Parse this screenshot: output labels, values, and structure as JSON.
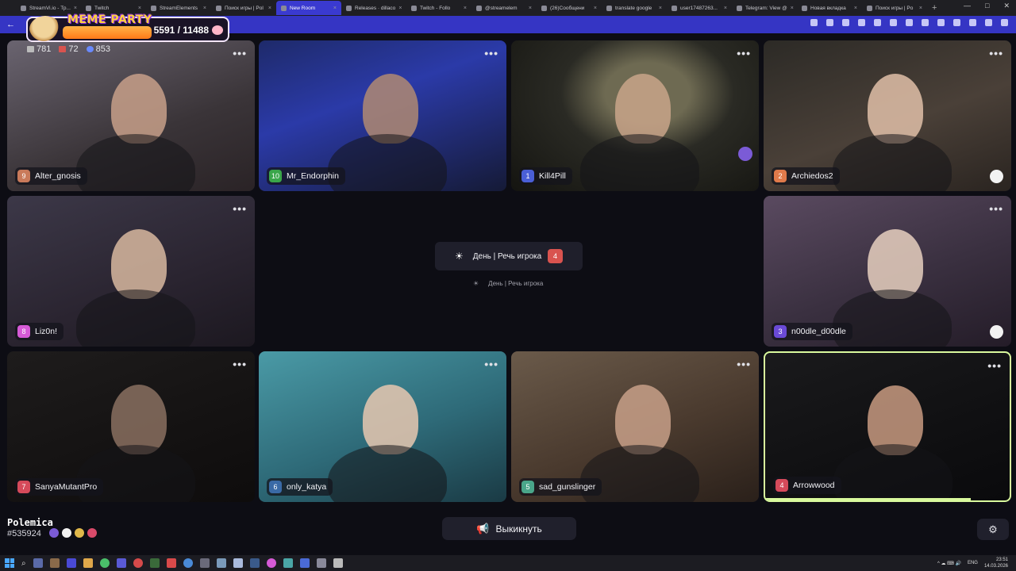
{
  "browser": {
    "tabs": [
      {
        "label": "StreamVi.io - Тр..."
      },
      {
        "label": "Twitch"
      },
      {
        "label": "StreamElements"
      },
      {
        "label": "Поиск игры | Pol"
      },
      {
        "label": "New Room",
        "active": true
      },
      {
        "label": "Releases · dillaco"
      },
      {
        "label": "Twitch - Follo"
      },
      {
        "label": "@streamelem"
      },
      {
        "label": "(26)Сообщени"
      },
      {
        "label": "translate google"
      },
      {
        "label": "user17487263..."
      },
      {
        "label": "Telegram: View @"
      },
      {
        "label": "Новая вкладка"
      },
      {
        "label": "Поиск игры | Po"
      }
    ],
    "new_tab": "+",
    "back": "←"
  },
  "overlay": {
    "title": "MEME PARTY",
    "score": "5591 / 11488"
  },
  "stats": {
    "chat": "781",
    "viewers": "72",
    "followers": "853"
  },
  "players": [
    {
      "num": "9",
      "name": "Alter_gnosis",
      "color": "#c97a5a"
    },
    {
      "num": "10",
      "name": "Mr_Endorphin",
      "color": "#3aa64a"
    },
    {
      "num": "1",
      "name": "Kill4Pill",
      "color": "#4a5fd6"
    },
    {
      "num": "2",
      "name": "Archiedos2",
      "color": "#e07a4a"
    },
    {
      "num": "8",
      "name": "Liz0n!",
      "color": "#d65ad6"
    },
    {
      "num": "3",
      "name": "n00dle_d00dle",
      "color": "#6a4ad6"
    },
    {
      "num": "7",
      "name": "SanyaMutantPro",
      "color": "#d64a5a"
    },
    {
      "num": "6",
      "name": "only_katya",
      "color": "#3a6aa6"
    },
    {
      "num": "5",
      "name": "sad_gunslinger",
      "color": "#4aa68a"
    },
    {
      "num": "4",
      "name": "Arrowwood",
      "color": "#d64a5a",
      "speaking_progress": 0.84
    }
  ],
  "phase": {
    "label": "День | Речь игрока",
    "count": "4",
    "sub_label": "День | Речь игрока",
    "icon": "sun-icon"
  },
  "brand": {
    "name": "Polemica",
    "room_id": "#535924"
  },
  "actions": {
    "kick_label": "Выкикнуть"
  },
  "taskbar": {
    "lang": "ENG",
    "time": "23:51",
    "date": "14.03.2026"
  }
}
